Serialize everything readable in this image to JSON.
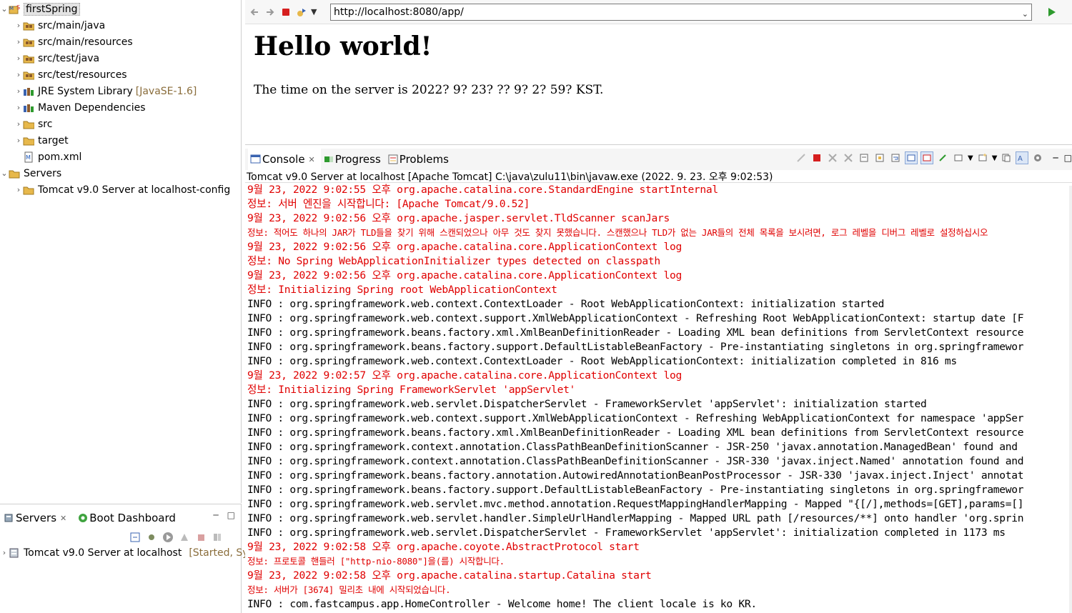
{
  "explorer": {
    "project": "firstSpring",
    "items": [
      {
        "label": "src/main/java",
        "icon": "package-folder-icon",
        "deco": ""
      },
      {
        "label": "src/main/resources",
        "icon": "package-folder-icon",
        "deco": ""
      },
      {
        "label": "src/test/java",
        "icon": "package-folder-icon",
        "deco": ""
      },
      {
        "label": "src/test/resources",
        "icon": "package-folder-icon",
        "deco": ""
      },
      {
        "label": "JRE System Library",
        "icon": "library-icon",
        "deco": "[JavaSE-1.6]"
      },
      {
        "label": "Maven Dependencies",
        "icon": "library-icon",
        "deco": ""
      },
      {
        "label": "src",
        "icon": "folder-icon",
        "deco": ""
      },
      {
        "label": "target",
        "icon": "folder-icon",
        "deco": ""
      },
      {
        "label": "pom.xml",
        "icon": "maven-file-icon",
        "deco": ""
      }
    ],
    "servers_project": "Servers",
    "servers_child": "Tomcat v9.0 Server at localhost-config"
  },
  "servers_view": {
    "tab_servers": "Servers",
    "tab_boot": "Boot Dashboard",
    "server_name": "Tomcat v9.0 Server at localhost",
    "server_state": "[Started, Sy"
  },
  "browser": {
    "url": "http://localhost:8080/app/",
    "heading": "Hello world!",
    "text": "The time on the server is 2022? 9? 23? ?? 9? 2? 59? KST."
  },
  "console": {
    "tab_console": "Console",
    "tab_progress": "Progress",
    "tab_problems": "Problems",
    "description": "Tomcat v9.0 Server at localhost [Apache Tomcat] C:\\java\\zulu11\\bin\\javaw.exe  (2022. 9. 23. 오후 9:02:53)",
    "lines": [
      {
        "t": "9월 23, 2022 9:02:55 오후 org.apache.catalina.core.StandardEngine startInternal",
        "c": "err"
      },
      {
        "t": "정보: 서버 엔진을 시작합니다: [Apache Tomcat/9.0.52]",
        "c": "err"
      },
      {
        "t": "9월 23, 2022 9:02:56 오후 org.apache.jasper.servlet.TldScanner scanJars",
        "c": "err"
      },
      {
        "t": "정보: 적어도 하나의 JAR가 TLD들을 찾기 위해 스캔되었으나 아무 것도 찾지 못했습니다. 스캔했으나 TLD가 없는 JAR들의 전체 목록을 보시려면, 로그 레벨을 디버그 레벨로 설정하십시오",
        "c": "err small"
      },
      {
        "t": "9월 23, 2022 9:02:56 오후 org.apache.catalina.core.ApplicationContext log",
        "c": "err"
      },
      {
        "t": "정보: No Spring WebApplicationInitializer types detected on classpath",
        "c": "err"
      },
      {
        "t": "9월 23, 2022 9:02:56 오후 org.apache.catalina.core.ApplicationContext log",
        "c": "err"
      },
      {
        "t": "정보: Initializing Spring root WebApplicationContext",
        "c": "err"
      },
      {
        "t": "INFO : org.springframework.web.context.ContextLoader - Root WebApplicationContext: initialization started",
        "c": "out"
      },
      {
        "t": "INFO : org.springframework.web.context.support.XmlWebApplicationContext - Refreshing Root WebApplicationContext: startup date [F",
        "c": "out"
      },
      {
        "t": "INFO : org.springframework.beans.factory.xml.XmlBeanDefinitionReader - Loading XML bean definitions from ServletContext resource",
        "c": "out"
      },
      {
        "t": "INFO : org.springframework.beans.factory.support.DefaultListableBeanFactory - Pre-instantiating singletons in org.springframewor",
        "c": "out"
      },
      {
        "t": "INFO : org.springframework.web.context.ContextLoader - Root WebApplicationContext: initialization completed in 816 ms",
        "c": "out"
      },
      {
        "t": "9월 23, 2022 9:02:57 오후 org.apache.catalina.core.ApplicationContext log",
        "c": "err"
      },
      {
        "t": "정보: Initializing Spring FrameworkServlet 'appServlet'",
        "c": "err"
      },
      {
        "t": "INFO : org.springframework.web.servlet.DispatcherServlet - FrameworkServlet 'appServlet': initialization started",
        "c": "out"
      },
      {
        "t": "INFO : org.springframework.web.context.support.XmlWebApplicationContext - Refreshing WebApplicationContext for namespace 'appSer",
        "c": "out"
      },
      {
        "t": "INFO : org.springframework.beans.factory.xml.XmlBeanDefinitionReader - Loading XML bean definitions from ServletContext resource",
        "c": "out"
      },
      {
        "t": "INFO : org.springframework.context.annotation.ClassPathBeanDefinitionScanner - JSR-250 'javax.annotation.ManagedBean' found and",
        "c": "out"
      },
      {
        "t": "INFO : org.springframework.context.annotation.ClassPathBeanDefinitionScanner - JSR-330 'javax.inject.Named' annotation found and",
        "c": "out"
      },
      {
        "t": "INFO : org.springframework.beans.factory.annotation.AutowiredAnnotationBeanPostProcessor - JSR-330 'javax.inject.Inject' annotat",
        "c": "out"
      },
      {
        "t": "INFO : org.springframework.beans.factory.support.DefaultListableBeanFactory - Pre-instantiating singletons in org.springframewor",
        "c": "out"
      },
      {
        "t": "INFO : org.springframework.web.servlet.mvc.method.annotation.RequestMappingHandlerMapping - Mapped \"{[/],methods=[GET],params=[]",
        "c": "out"
      },
      {
        "t": "INFO : org.springframework.web.servlet.handler.SimpleUrlHandlerMapping - Mapped URL path [/resources/**] onto handler 'org.sprin",
        "c": "out"
      },
      {
        "t": "INFO : org.springframework.web.servlet.DispatcherServlet - FrameworkServlet 'appServlet': initialization completed in 1173 ms",
        "c": "out"
      },
      {
        "t": "9월 23, 2022 9:02:58 오후 org.apache.coyote.AbstractProtocol start",
        "c": "err"
      },
      {
        "t": "정보: 프로토콜 핸들러 [\"http-nio-8080\"]을(를) 시작합니다.",
        "c": "err small"
      },
      {
        "t": "9월 23, 2022 9:02:58 오후 org.apache.catalina.startup.Catalina start",
        "c": "err"
      },
      {
        "t": "정보: 서버가 [3674] 밀리초 내에 시작되었습니다.",
        "c": "err small"
      },
      {
        "t": "INFO : com.fastcampus.app.HomeController - Welcome home! The client locale is ko_KR.",
        "c": "out"
      }
    ]
  },
  "colors": {
    "stderr": "#e00000",
    "stdout": "#000000",
    "stop_red": "#d61f1f",
    "run_green": "#2e9a2e",
    "folder_yellow": "#e7b84b"
  }
}
